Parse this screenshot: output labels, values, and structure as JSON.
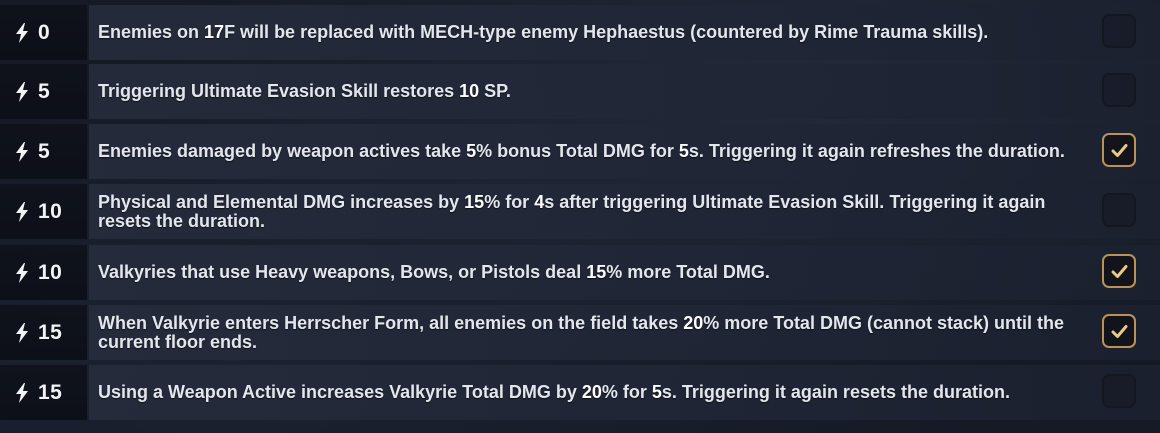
{
  "rows": [
    {
      "cost": "0",
      "parts": [
        {
          "t": "Enemies on ",
          "h": false
        },
        {
          "t": "17",
          "h": true
        },
        {
          "t": "F will be replaced with MECH-type enemy Hephaestus (countered by Rime Trauma skills).",
          "h": false
        }
      ],
      "checked": false
    },
    {
      "cost": "5",
      "parts": [
        {
          "t": "Triggering Ultimate Evasion Skill restores ",
          "h": false
        },
        {
          "t": "10",
          "h": true
        },
        {
          "t": " SP.",
          "h": false
        }
      ],
      "checked": false
    },
    {
      "cost": "5",
      "parts": [
        {
          "t": "Enemies damaged by weapon actives take ",
          "h": false
        },
        {
          "t": "5",
          "h": true
        },
        {
          "t": "% bonus Total DMG for ",
          "h": false
        },
        {
          "t": "5",
          "h": true
        },
        {
          "t": "s. Triggering it again refreshes the duration.",
          "h": false
        }
      ],
      "checked": true
    },
    {
      "cost": "10",
      "parts": [
        {
          "t": "Physical and Elemental DMG increases by ",
          "h": false
        },
        {
          "t": "15",
          "h": true
        },
        {
          "t": "% for ",
          "h": false
        },
        {
          "t": "4",
          "h": true
        },
        {
          "t": "s after triggering Ultimate Evasion Skill. Triggering it again resets the duration.",
          "h": false
        }
      ],
      "checked": false
    },
    {
      "cost": "10",
      "parts": [
        {
          "t": "Valkyries that use Heavy weapons, Bows, or Pistols deal ",
          "h": false
        },
        {
          "t": "15",
          "h": true
        },
        {
          "t": "% more Total DMG.",
          "h": false
        }
      ],
      "checked": true
    },
    {
      "cost": "15",
      "parts": [
        {
          "t": "When Valkyrie enters Herrscher Form, all enemies on the field takes ",
          "h": false
        },
        {
          "t": "20",
          "h": true
        },
        {
          "t": "% more Total DMG (cannot stack) until the current floor ends.",
          "h": false
        }
      ],
      "checked": true
    },
    {
      "cost": "15",
      "parts": [
        {
          "t": "Using a Weapon Active increases Valkyrie Total DMG by ",
          "h": false
        },
        {
          "t": "20",
          "h": true
        },
        {
          "t": "% for ",
          "h": false
        },
        {
          "t": "5",
          "h": true
        },
        {
          "t": "s. Triggering it again resets the duration.",
          "h": false
        }
      ],
      "checked": false
    }
  ],
  "icons": {
    "cost": "lightning-bolt-icon",
    "check": "checkmark-icon"
  },
  "colors": {
    "accent": "#e8c98a",
    "checkbox_border": "#b8925a"
  }
}
